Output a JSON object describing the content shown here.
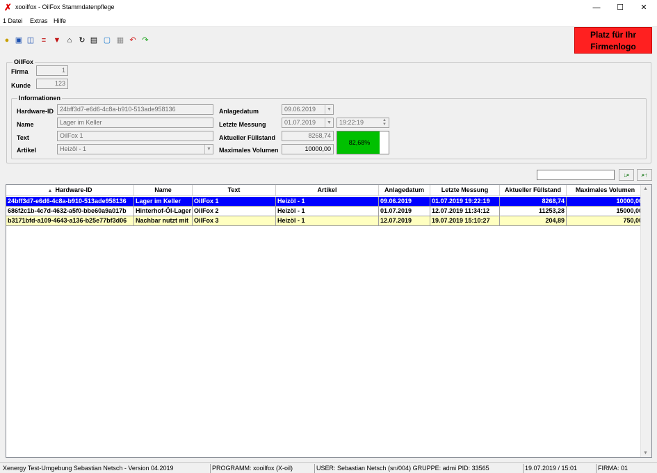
{
  "window": {
    "title": "xooilfox - OilFox Stammdatenpflege",
    "minimize": "—",
    "maximize": "☐",
    "close": "✕"
  },
  "menu": [
    "1 Datei",
    "Extras",
    "Hilfe"
  ],
  "toolbar_icons": [
    "lightbulb-icon",
    "monitor-icon",
    "book-icon",
    "database-icon",
    "filter-icon",
    "home-icon",
    "refresh-icon",
    "print-icon",
    "screen-icon",
    "save-icon",
    "undo-icon",
    "redo-icon"
  ],
  "logo": {
    "line1": "Platz für Ihr",
    "line2": "Firmenlogo"
  },
  "oilfox_group": {
    "title": "OilFox",
    "firma_label": "Firma",
    "firma_value": "1",
    "kunde_label": "Kunde",
    "kunde_value": "123"
  },
  "info_group": {
    "title": "Informationen",
    "hardware_label": "Hardware-ID",
    "hardware_value": "24bff3d7-e6d6-4c8a-b910-513ade958136",
    "name_label": "Name",
    "name_value": "Lager im Keller",
    "text_label": "Text",
    "text_value": "OilFox 1",
    "artikel_label": "Artikel",
    "artikel_value": "Heizöl - 1",
    "anlage_label": "Anlagedatum",
    "anlage_value": "09.06.2019",
    "letzte_label": "Letzte Messung",
    "letzte_date": "01.07.2019",
    "letzte_time": "19:22:19",
    "fuell_label": "Aktueller Füllstand",
    "fuell_value": "8268,74",
    "maxvol_label": "Maximales Volumen",
    "maxvol_value": "10000,00",
    "gauge_text": "82,68%",
    "gauge_fraction": 0.8268
  },
  "grid": {
    "columns": [
      "Hardware-ID",
      "Name",
      "Text",
      "Artikel",
      "Anlagedatum",
      "Letzte Messung",
      "Aktueller Füllstand",
      "Maximales Volumen"
    ],
    "sort_indicator": "▲",
    "rows": [
      [
        "24bff3d7-e6d6-4c8a-b910-513ade958136",
        "Lager im Keller",
        "OilFox 1",
        "Heizöl - 1",
        "09.06.2019",
        "01.07.2019 19:22:19",
        "8268,74",
        "10000,00"
      ],
      [
        "686f2c1b-4c7d-4632-a5f0-bbe60a9a017b",
        "Hinterhof-Öl-Lager",
        "OilFox 2",
        "Heizöl - 1",
        "01.07.2019",
        "12.07.2019 11:34:12",
        "11253,28",
        "15000,00"
      ],
      [
        "b3171bfd-a109-4643-a136-b25e77bf3d06",
        "Nachbar nutzt mit",
        "OilFox 3",
        "Heizöl - 1",
        "12.07.2019",
        "19.07.2019 15:10:27",
        "204,89",
        "750,00"
      ]
    ],
    "row_colors": [
      "#0000ff",
      "#ffffff",
      "#ffffc0"
    ],
    "row_text_colors": [
      "#ffffff",
      "#000000",
      "#000000"
    ]
  },
  "status": {
    "env": "Xenergy Test-Umgebung Sebastian Netsch - Version 04.2019",
    "program": "PROGRAMM: xooilfox (X-oil)",
    "user": "USER: Sebastian Netsch (sn/004)  GRUPPE: admi  PID: 33565",
    "datetime": "19.07.2019 / 15:01",
    "firma": "FIRMA: 01"
  }
}
